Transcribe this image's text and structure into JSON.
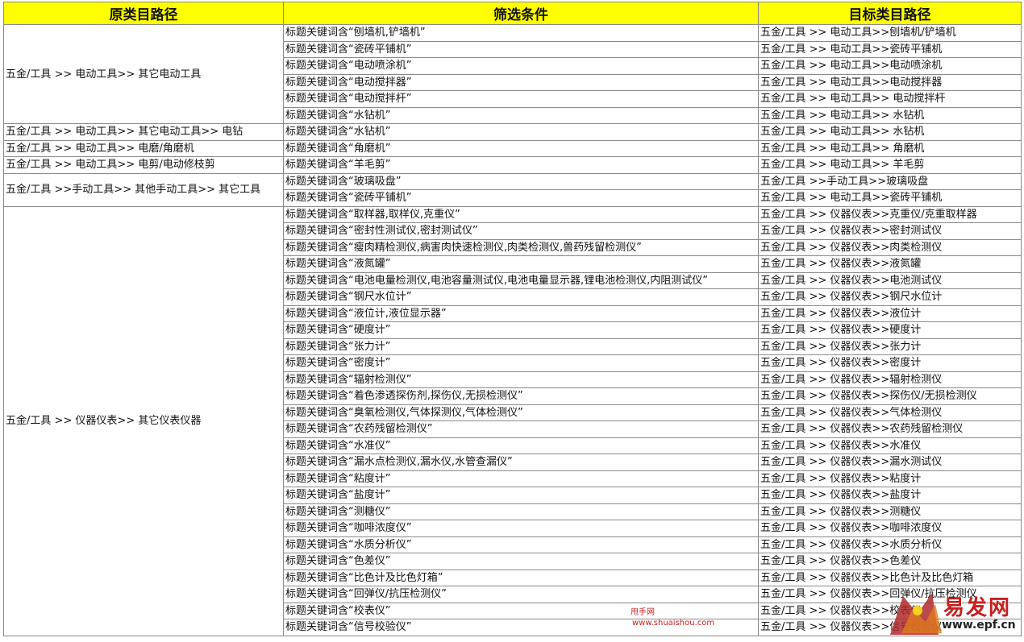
{
  "headers": [
    "原类目路径",
    "筛选条件",
    "目标类目路径"
  ],
  "groups": [
    {
      "source": "五金/工具 >> 电动工具>> 其它电动工具",
      "rows": [
        [
          "标题关键词含“刨墙机,铲墙机”",
          "五金/工具 >> 电动工具>>刨墙机/铲墙机"
        ],
        [
          "标题关键词含“瓷砖平铺机”",
          "五金/工具 >> 电动工具>>瓷砖平铺机"
        ],
        [
          "标题关键词含“电动喷涂机”",
          "五金/工具 >> 电动工具>>电动喷涂机"
        ],
        [
          "标题关键词含“电动搅拌器”",
          "五金/工具 >> 电动工具>>电动搅拌器"
        ],
        [
          "标题关键词含“电动搅拌杆”",
          "五金/工具 >> 电动工具>> 电动搅拌杆"
        ],
        [
          "标题关键词含“水钻机”",
          "五金/工具 >> 电动工具>> 水钻机"
        ]
      ]
    },
    {
      "source": "五金/工具 >> 电动工具>> 其它电动工具>> 电钻",
      "rows": [
        [
          "标题关键词含“水钻机”",
          "五金/工具 >> 电动工具>> 水钻机"
        ]
      ]
    },
    {
      "source": "五金/工具 >> 电动工具>> 电磨/角磨机",
      "rows": [
        [
          "标题关键词含“角磨机”",
          "五金/工具 >> 电动工具>> 角磨机"
        ]
      ]
    },
    {
      "source": "五金/工具 >> 电动工具>> 电剪/电动修枝剪",
      "rows": [
        [
          "标题关键词含“羊毛剪”",
          "五金/工具 >> 电动工具>> 羊毛剪"
        ]
      ]
    },
    {
      "source": "五金/工具 >>手动工具>> 其他手动工具>> 其它工具",
      "rows": [
        [
          "标题关键词含“玻璃吸盘”",
          "五金/工具 >>手动工具>>玻璃吸盘"
        ],
        [
          "标题关键词含“瓷砖平铺机”",
          "五金/工具 >> 电动工具>>瓷砖平铺机"
        ]
      ]
    },
    {
      "source": "五金/工具 >> 仪器仪表>> 其它仪表仪器",
      "rows": [
        [
          "标题关键词含“取样器,取样仪,克重仪”",
          "五金/工具 >> 仪器仪表>>克重仪/克重取样器"
        ],
        [
          "标题关键词含“密封性测试仪,密封测试仪”",
          "五金/工具 >> 仪器仪表>>密封测试仪"
        ],
        [
          "标题关键词含“瘦肉精检测仪,病害肉快速检测仪,肉类检测仪,兽药残留检测仪”",
          "五金/工具 >> 仪器仪表>>肉类检测仪"
        ],
        [
          "标题关键词含“液氮罐”",
          "五金/工具 >> 仪器仪表>>液氮罐"
        ],
        [
          "标题关键词含“电池电量检测仪,电池容量测试仪,电池电量显示器,锂电池检测仪,内阻测试仪”",
          "五金/工具 >> 仪器仪表>>电池测试仪"
        ],
        [
          "标题关键词含“钢尺水位计”",
          "五金/工具 >> 仪器仪表>>钢尺水位计"
        ],
        [
          "标题关键词含“液位计,液位显示器”",
          "五金/工具 >> 仪器仪表>>液位计"
        ],
        [
          "标题关键词含“硬度计”",
          "五金/工具 >> 仪器仪表>>硬度计"
        ],
        [
          "标题关键词含“张力计”",
          "五金/工具 >> 仪器仪表>>张力计"
        ],
        [
          "标题关键词含“密度计”",
          "五金/工具 >> 仪器仪表>>密度计"
        ],
        [
          "标题关键词含“辐射检测仪”",
          "五金/工具 >> 仪器仪表>>辐射检测仪"
        ],
        [
          "标题关键词含“着色渗透探伤剂,探伤仪,无损检测仪”",
          "五金/工具 >> 仪器仪表>>探伤仪/无损检测仪"
        ],
        [
          "标题关键词含“臭氧检测仪,气体探测仪,气体检测仪”",
          "五金/工具 >> 仪器仪表>>气体检测仪"
        ],
        [
          "标题关键词含“农药残留检测仪”",
          "五金/工具 >> 仪器仪表>>农药残留检测仪"
        ],
        [
          "标题关键词含“水准仪”",
          "五金/工具 >> 仪器仪表>>水准仪"
        ],
        [
          "标题关键词含“漏水点检测仪,漏水仪,水管查漏仪”",
          "五金/工具 >> 仪器仪表>>漏水测试仪"
        ],
        [
          "标题关键词含“粘度计”",
          "五金/工具 >> 仪器仪表>>粘度计"
        ],
        [
          "标题关键词含“盐度计”",
          "五金/工具 >> 仪器仪表>>盐度计"
        ],
        [
          "标题关键词含“测糖仪”",
          "五金/工具 >> 仪器仪表>>测糖仪"
        ],
        [
          "标题关键词含“咖啡浓度仪”",
          "五金/工具 >> 仪器仪表>>咖啡浓度仪"
        ],
        [
          "标题关键词含“水质分析仪”",
          "五金/工具 >> 仪器仪表>>水质分析仪"
        ],
        [
          "标题关键词含“色差仪”",
          "五金/工具 >> 仪器仪表>>色差仪"
        ],
        [
          "标题关键词含“比色计及比色灯箱”",
          "五金/工具 >> 仪器仪表>>比色计及比色灯箱"
        ],
        [
          "标题关键词含“回弹仪/抗压检测仪”",
          "五金/工具 >> 仪器仪表>>回弹仪/抗压检测仪"
        ],
        [
          "标题关键词含“校表仪”",
          "五金/工具 >> 仪器仪表>>校表仪"
        ],
        [
          "标题关键词含“信号校验仪”",
          "五金/工具 >> 仪器仪表>>信号校验仪"
        ]
      ]
    }
  ],
  "watermark": {
    "line1": "甩手网",
    "line2": "www.shuaishou.com"
  },
  "logo": {
    "text": "易发网",
    "url": "www.epf.cn"
  }
}
